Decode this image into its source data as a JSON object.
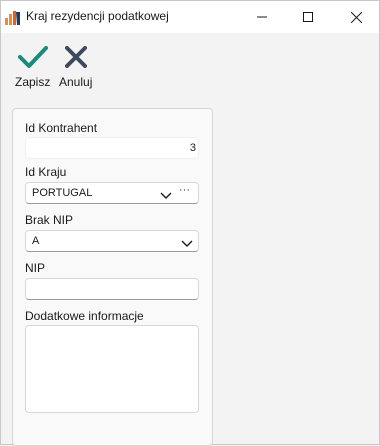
{
  "window": {
    "title": "Kraj rezydencji podatkowej"
  },
  "toolbar": {
    "save_label": "Zapisz",
    "cancel_label": "Anuluj",
    "save_color": "#1a8a7a",
    "cancel_color": "#3d4a5c"
  },
  "form": {
    "id_kontrahent": {
      "label": "Id Kontrahent",
      "value": "3"
    },
    "id_kraju": {
      "label": "Id Kraju",
      "value": "PORTUGAL",
      "more_label": "···"
    },
    "brak_nip": {
      "label": "Brak NIP",
      "value": "A"
    },
    "nip": {
      "label": "NIP",
      "value": ""
    },
    "dodatkowe": {
      "label": "Dodatkowe informacje",
      "value": ""
    }
  }
}
